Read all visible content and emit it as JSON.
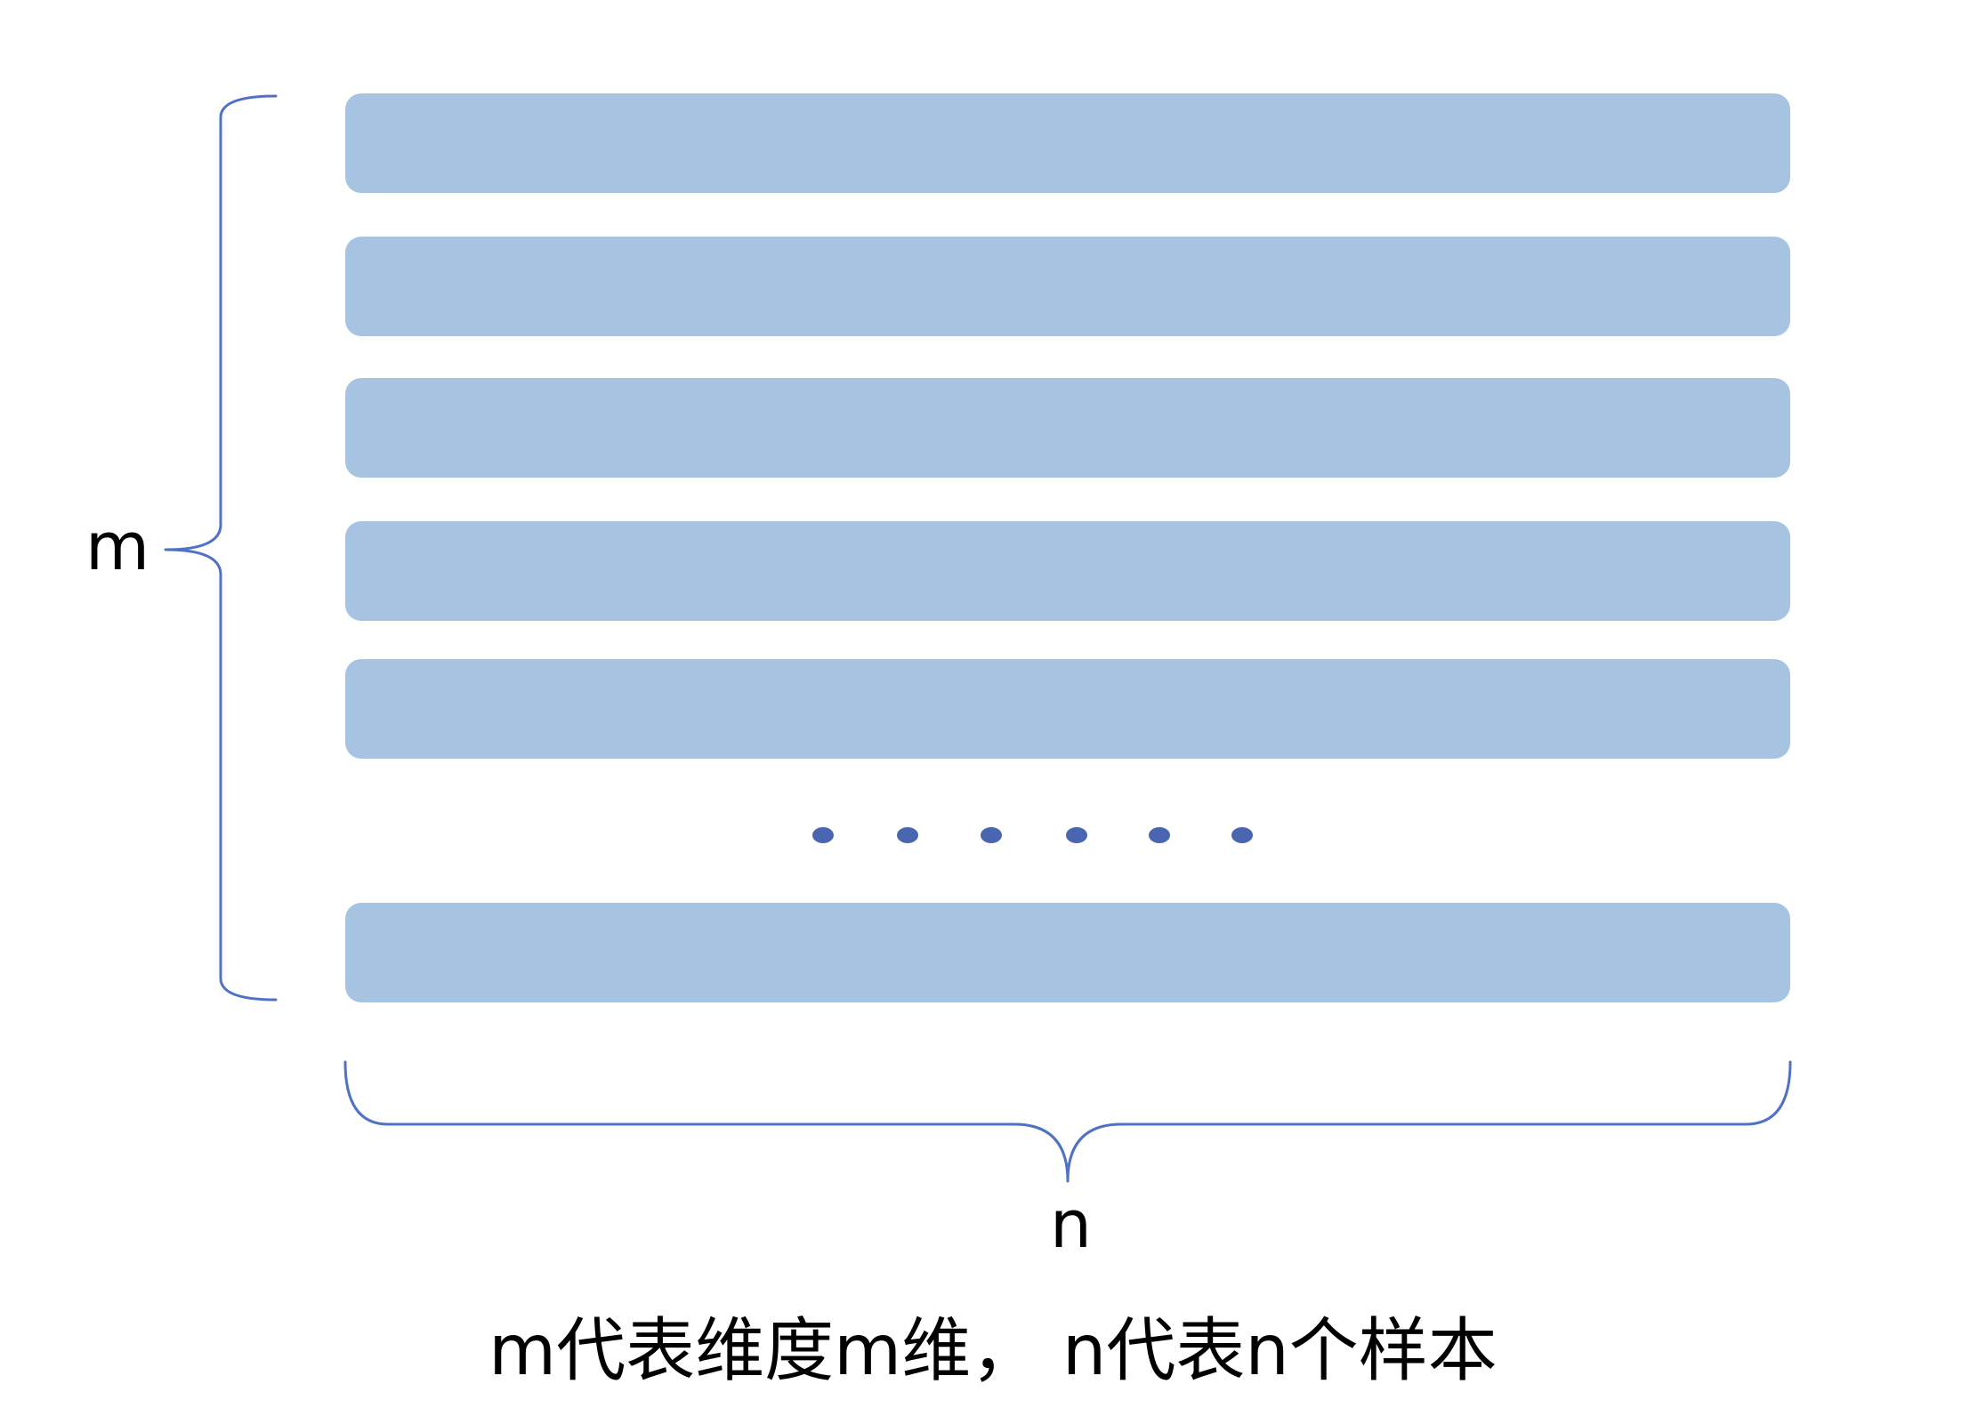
{
  "diagram": {
    "row_count_visible": 6,
    "dot_count": 6,
    "colors": {
      "bar_fill": "#a6c3e2",
      "brace_stroke": "#4f72c5",
      "dot_fill": "#4a66b0",
      "text": "#000000"
    },
    "labels": {
      "rows_brace": "m",
      "cols_brace": "n"
    },
    "caption": "m代表维度m维，  n代表n个样本"
  }
}
